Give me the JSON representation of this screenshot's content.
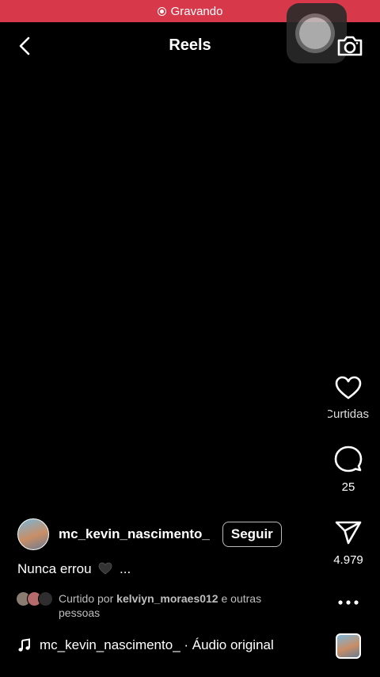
{
  "status_bar": {
    "recording_label": "Gravando"
  },
  "header": {
    "title": "Reels"
  },
  "actions": {
    "likes_label": "Curtidas",
    "comments_count": "25",
    "shares_count": "4.979"
  },
  "post": {
    "author": "mc_kevin_nascimento_",
    "follow_label": "Seguir",
    "caption_start": "Nunca errou",
    "caption_end": "...",
    "liked_prefix": "Curtido por",
    "liked_user": "kelviyn_moraes012",
    "liked_suffix": "e outras pessoas",
    "audio": "mc_kevin_nascimento_ · Áudio original"
  },
  "icons": [
    "chevron-left-icon",
    "camera-icon",
    "heart-icon",
    "comment-icon",
    "share-icon",
    "more-icon",
    "music-note-icon",
    "record-icon"
  ],
  "colors": {
    "recording_bar": "#d8394a",
    "background": "#000000"
  }
}
